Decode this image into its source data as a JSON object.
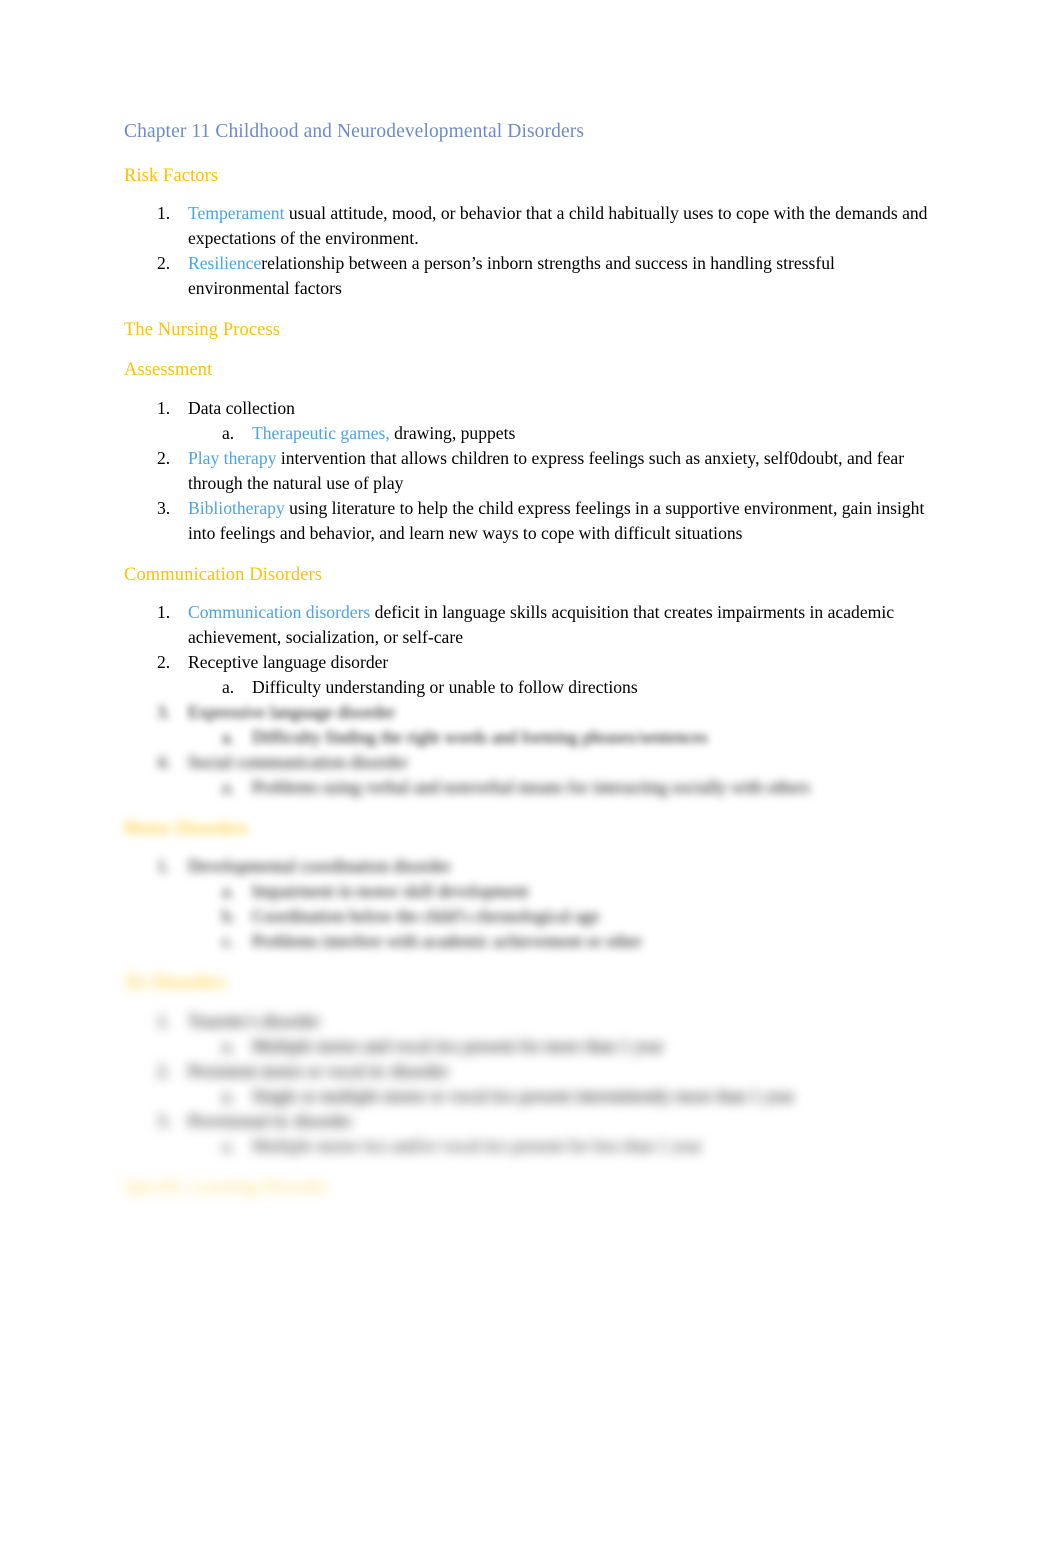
{
  "document": {
    "title": "Chapter 11 Childhood and Neurodevelopmental Disorders",
    "colors": {
      "title": "#6d8ac9",
      "heading": "#ffc000",
      "accent": "#4aa3e3",
      "body": "#000000",
      "page_background": "#ffffff"
    }
  },
  "sections": [
    {
      "heading": "Risk Factors",
      "items": [
        {
          "marker": "1.",
          "term": "Temperament",
          "text": " usual attitude, mood, or behavior that a child habitually uses to cope with the demands and expectations of the environment."
        },
        {
          "marker": "2.",
          "term": "Resilience",
          "text": "relationship between a person’s inborn strengths and success in handling stressful environmental factors"
        }
      ]
    },
    {
      "heading": "The Nursing Process",
      "items": []
    },
    {
      "heading": "Assessment",
      "items": [
        {
          "marker": "1.",
          "term": "",
          "text": "Data collection",
          "sub": [
            {
              "marker": "a.",
              "term": "Therapeutic games,",
              "text": " drawing, puppets"
            }
          ]
        },
        {
          "marker": "2.",
          "term": "Play therapy",
          "text": " intervention that allows children to express feelings such as anxiety, self0doubt, and fear through the natural use of play"
        },
        {
          "marker": "3.",
          "term": "Bibliotherapy",
          "text": " using literature to help the child express feelings in a supportive environment, gain insight into feelings and behavior, and learn new ways to cope with difficult situations"
        }
      ]
    },
    {
      "heading": "Communication Disorders",
      "items": [
        {
          "marker": "1.",
          "term": "Communication disorders",
          "text": " deficit in language skills acquisition that creates impairments in academic achievement, socialization, or self-care"
        },
        {
          "marker": "2.",
          "term": "",
          "text": "Receptive language disorder",
          "sub": [
            {
              "marker": "a.",
              "term": "",
              "text": "Difficulty understanding or unable to follow directions"
            }
          ]
        },
        {
          "marker": "3.",
          "term": "",
          "text": "Expressive language disorder",
          "blurred": true,
          "sub": [
            {
              "marker": "a.",
              "term": "",
              "text": "Difficulty finding the right words and forming phrases/sentences",
              "blurred": true
            }
          ]
        },
        {
          "marker": "4.",
          "term": "",
          "text": "Social communication disorder",
          "blurred": true,
          "sub": [
            {
              "marker": "a.",
              "term": "",
              "text": "Problems using verbal and nonverbal means for interacting socially with others",
              "blurred": true
            }
          ]
        }
      ]
    },
    {
      "heading": "Motor Disorders",
      "blurred": true,
      "items": [
        {
          "marker": "1.",
          "term": "",
          "text": "Developmental coordination disorder",
          "blurred": true,
          "sub": [
            {
              "marker": "a.",
              "term": "",
              "text": "Impairment in motor skill development",
              "blurred": true
            },
            {
              "marker": "b.",
              "term": "",
              "text": "Coordination below the child’s chronological age",
              "blurred": true
            },
            {
              "marker": "c.",
              "term": "",
              "text": "Problems interfere with academic achievement or other",
              "blurred": true
            }
          ]
        }
      ]
    },
    {
      "heading": "Tic Disorders",
      "blurred": true,
      "items": [
        {
          "marker": "1.",
          "term": "",
          "text": "Tourette’s disorder",
          "blurred": true,
          "sub": [
            {
              "marker": "a.",
              "term": "",
              "text": "Multiple motor and vocal tics present for more than 1 year",
              "blurred": true
            }
          ]
        },
        {
          "marker": "2.",
          "term": "",
          "text": "Persistent motor or vocal tic disorder",
          "blurred": true,
          "sub": [
            {
              "marker": "a.",
              "term": "",
              "text": "Single or multiple motor or vocal tics present intermittently more than 1 year",
              "blurred": true
            }
          ]
        },
        {
          "marker": "3.",
          "term": "",
          "text": "Provisional tic disorder",
          "blurred": true,
          "sub": [
            {
              "marker": "a.",
              "term": "",
              "text": "Multiple motor tics and/or vocal tics present for less than 1 year",
              "blurred": true
            }
          ]
        }
      ]
    },
    {
      "heading": "Specific Learning Disorder",
      "blurred": true,
      "items": []
    }
  ]
}
